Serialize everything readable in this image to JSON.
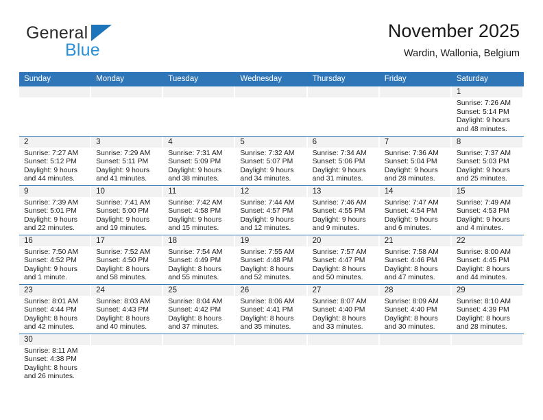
{
  "logo": {
    "word_top": "General",
    "word_bottom": "Blue",
    "triangle_icon": "triangle-icon",
    "color_dark": "#2b2b2b",
    "color_blue": "#2b8fd6",
    "color_triangle": "#1c74bb"
  },
  "header": {
    "title": "November 2025",
    "subtitle": "Wardin, Wallonia, Belgium"
  },
  "theme": {
    "header_blue": "#2f76b8",
    "daynum_band": "#f2f2f2",
    "text": "#1c1c1c"
  },
  "weekday_headers": [
    "Sunday",
    "Monday",
    "Tuesday",
    "Wednesday",
    "Thursday",
    "Friday",
    "Saturday"
  ],
  "weeks": [
    [
      {
        "blank": true
      },
      {
        "blank": true
      },
      {
        "blank": true
      },
      {
        "blank": true
      },
      {
        "blank": true
      },
      {
        "blank": true
      },
      {
        "day": "1",
        "sunrise": "Sunrise: 7:26 AM",
        "sunset": "Sunset: 5:14 PM",
        "daylight1": "Daylight: 9 hours",
        "daylight2": "and 48 minutes."
      }
    ],
    [
      {
        "day": "2",
        "sunrise": "Sunrise: 7:27 AM",
        "sunset": "Sunset: 5:12 PM",
        "daylight1": "Daylight: 9 hours",
        "daylight2": "and 44 minutes."
      },
      {
        "day": "3",
        "sunrise": "Sunrise: 7:29 AM",
        "sunset": "Sunset: 5:11 PM",
        "daylight1": "Daylight: 9 hours",
        "daylight2": "and 41 minutes."
      },
      {
        "day": "4",
        "sunrise": "Sunrise: 7:31 AM",
        "sunset": "Sunset: 5:09 PM",
        "daylight1": "Daylight: 9 hours",
        "daylight2": "and 38 minutes."
      },
      {
        "day": "5",
        "sunrise": "Sunrise: 7:32 AM",
        "sunset": "Sunset: 5:07 PM",
        "daylight1": "Daylight: 9 hours",
        "daylight2": "and 34 minutes."
      },
      {
        "day": "6",
        "sunrise": "Sunrise: 7:34 AM",
        "sunset": "Sunset: 5:06 PM",
        "daylight1": "Daylight: 9 hours",
        "daylight2": "and 31 minutes."
      },
      {
        "day": "7",
        "sunrise": "Sunrise: 7:36 AM",
        "sunset": "Sunset: 5:04 PM",
        "daylight1": "Daylight: 9 hours",
        "daylight2": "and 28 minutes."
      },
      {
        "day": "8",
        "sunrise": "Sunrise: 7:37 AM",
        "sunset": "Sunset: 5:03 PM",
        "daylight1": "Daylight: 9 hours",
        "daylight2": "and 25 minutes."
      }
    ],
    [
      {
        "day": "9",
        "sunrise": "Sunrise: 7:39 AM",
        "sunset": "Sunset: 5:01 PM",
        "daylight1": "Daylight: 9 hours",
        "daylight2": "and 22 minutes."
      },
      {
        "day": "10",
        "sunrise": "Sunrise: 7:41 AM",
        "sunset": "Sunset: 5:00 PM",
        "daylight1": "Daylight: 9 hours",
        "daylight2": "and 19 minutes."
      },
      {
        "day": "11",
        "sunrise": "Sunrise: 7:42 AM",
        "sunset": "Sunset: 4:58 PM",
        "daylight1": "Daylight: 9 hours",
        "daylight2": "and 15 minutes."
      },
      {
        "day": "12",
        "sunrise": "Sunrise: 7:44 AM",
        "sunset": "Sunset: 4:57 PM",
        "daylight1": "Daylight: 9 hours",
        "daylight2": "and 12 minutes."
      },
      {
        "day": "13",
        "sunrise": "Sunrise: 7:46 AM",
        "sunset": "Sunset: 4:55 PM",
        "daylight1": "Daylight: 9 hours",
        "daylight2": "and 9 minutes."
      },
      {
        "day": "14",
        "sunrise": "Sunrise: 7:47 AM",
        "sunset": "Sunset: 4:54 PM",
        "daylight1": "Daylight: 9 hours",
        "daylight2": "and 6 minutes."
      },
      {
        "day": "15",
        "sunrise": "Sunrise: 7:49 AM",
        "sunset": "Sunset: 4:53 PM",
        "daylight1": "Daylight: 9 hours",
        "daylight2": "and 4 minutes."
      }
    ],
    [
      {
        "day": "16",
        "sunrise": "Sunrise: 7:50 AM",
        "sunset": "Sunset: 4:52 PM",
        "daylight1": "Daylight: 9 hours",
        "daylight2": "and 1 minute."
      },
      {
        "day": "17",
        "sunrise": "Sunrise: 7:52 AM",
        "sunset": "Sunset: 4:50 PM",
        "daylight1": "Daylight: 8 hours",
        "daylight2": "and 58 minutes."
      },
      {
        "day": "18",
        "sunrise": "Sunrise: 7:54 AM",
        "sunset": "Sunset: 4:49 PM",
        "daylight1": "Daylight: 8 hours",
        "daylight2": "and 55 minutes."
      },
      {
        "day": "19",
        "sunrise": "Sunrise: 7:55 AM",
        "sunset": "Sunset: 4:48 PM",
        "daylight1": "Daylight: 8 hours",
        "daylight2": "and 52 minutes."
      },
      {
        "day": "20",
        "sunrise": "Sunrise: 7:57 AM",
        "sunset": "Sunset: 4:47 PM",
        "daylight1": "Daylight: 8 hours",
        "daylight2": "and 50 minutes."
      },
      {
        "day": "21",
        "sunrise": "Sunrise: 7:58 AM",
        "sunset": "Sunset: 4:46 PM",
        "daylight1": "Daylight: 8 hours",
        "daylight2": "and 47 minutes."
      },
      {
        "day": "22",
        "sunrise": "Sunrise: 8:00 AM",
        "sunset": "Sunset: 4:45 PM",
        "daylight1": "Daylight: 8 hours",
        "daylight2": "and 44 minutes."
      }
    ],
    [
      {
        "day": "23",
        "sunrise": "Sunrise: 8:01 AM",
        "sunset": "Sunset: 4:44 PM",
        "daylight1": "Daylight: 8 hours",
        "daylight2": "and 42 minutes."
      },
      {
        "day": "24",
        "sunrise": "Sunrise: 8:03 AM",
        "sunset": "Sunset: 4:43 PM",
        "daylight1": "Daylight: 8 hours",
        "daylight2": "and 40 minutes."
      },
      {
        "day": "25",
        "sunrise": "Sunrise: 8:04 AM",
        "sunset": "Sunset: 4:42 PM",
        "daylight1": "Daylight: 8 hours",
        "daylight2": "and 37 minutes."
      },
      {
        "day": "26",
        "sunrise": "Sunrise: 8:06 AM",
        "sunset": "Sunset: 4:41 PM",
        "daylight1": "Daylight: 8 hours",
        "daylight2": "and 35 minutes."
      },
      {
        "day": "27",
        "sunrise": "Sunrise: 8:07 AM",
        "sunset": "Sunset: 4:40 PM",
        "daylight1": "Daylight: 8 hours",
        "daylight2": "and 33 minutes."
      },
      {
        "day": "28",
        "sunrise": "Sunrise: 8:09 AM",
        "sunset": "Sunset: 4:40 PM",
        "daylight1": "Daylight: 8 hours",
        "daylight2": "and 30 minutes."
      },
      {
        "day": "29",
        "sunrise": "Sunrise: 8:10 AM",
        "sunset": "Sunset: 4:39 PM",
        "daylight1": "Daylight: 8 hours",
        "daylight2": "and 28 minutes."
      }
    ],
    [
      {
        "day": "30",
        "sunrise": "Sunrise: 8:11 AM",
        "sunset": "Sunset: 4:38 PM",
        "daylight1": "Daylight: 8 hours",
        "daylight2": "and 26 minutes."
      },
      {
        "blank": true
      },
      {
        "blank": true
      },
      {
        "blank": true
      },
      {
        "blank": true
      },
      {
        "blank": true
      },
      {
        "blank": true
      }
    ]
  ]
}
